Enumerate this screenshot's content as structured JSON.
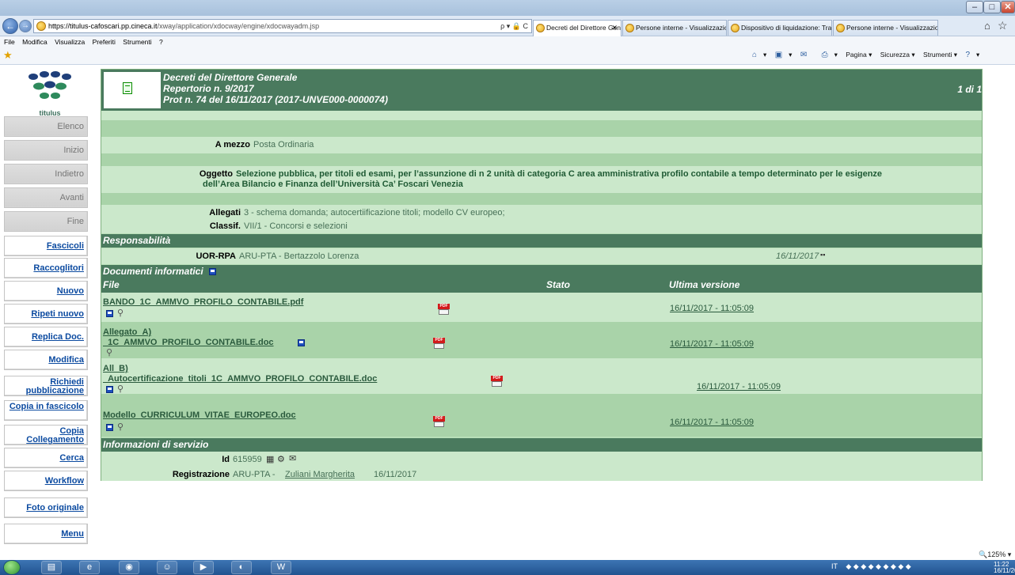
{
  "browser": {
    "address": {
      "host": "https://titulus-cafoscari.pp.cineca.it",
      "path": "/xway/application/xdocway/engine/xdocwayadm.jsp",
      "tools": "ρ ▾ 🔒 C"
    },
    "tabs": [
      {
        "label": "Decreti del Direttore Genera...",
        "active": true
      },
      {
        "label": "Persone interne - Visualizzazio..."
      },
      {
        "label": "Dispositivo di liquidazione: Tra..."
      },
      {
        "label": "Persone interne - Visualizzazio..."
      }
    ],
    "menu": [
      "File",
      "Modifica",
      "Visualizza",
      "Preferiti",
      "Strumenti",
      "?"
    ],
    "command_bar": [
      "Pagina ▾",
      "Sicurezza ▾",
      "Strumenti ▾"
    ],
    "zoom": "125%"
  },
  "logo": {
    "text": "titulus"
  },
  "sidebar": [
    {
      "label": "Elenco",
      "state": "disabled"
    },
    {
      "label": "Inizio",
      "state": "disabled"
    },
    {
      "label": "Indietro",
      "state": "disabled"
    },
    {
      "label": "Avanti",
      "state": "disabled"
    },
    {
      "label": "Fine",
      "state": "disabled"
    },
    {
      "label": "Fascicoli",
      "state": "active"
    },
    {
      "label": "Raccoglitori",
      "state": "active"
    },
    {
      "label": "Nuovo",
      "state": "active"
    },
    {
      "label": "Ripeti nuovo",
      "state": "active"
    },
    {
      "label": "Replica Doc.",
      "state": "active"
    },
    {
      "label": "Modifica",
      "state": "active"
    },
    {
      "label": "Richiedi pubblicazione",
      "state": "active"
    },
    {
      "label": "Copia in fascicolo",
      "state": "active"
    },
    {
      "label": "Copia Collegamento",
      "state": "active"
    },
    {
      "label": "Cerca",
      "state": "active"
    },
    {
      "label": "Workflow",
      "state": "active"
    },
    {
      "label": "Foto originale",
      "state": "active"
    },
    {
      "label": "Menu",
      "state": "active"
    }
  ],
  "doc": {
    "title": "Decreti del Direttore Generale",
    "repertorio": "Repertorio n. 9/2017",
    "protocollo": "Prot n. 74 del 16/11/2017  (2017-UNVE000-0000074)",
    "page": "1 di 1",
    "a_mezzo": {
      "label": "A mezzo",
      "value": "Posta Ordinaria"
    },
    "oggetto": {
      "label": "Oggetto",
      "line1": "Selezione pubblica, per titoli ed esami, per l’assunzione di n 2 unità di categoria C area amministrativa profilo contabile a tempo determinato per le esigenze",
      "line2": "dell’Area Bilancio e Finanza dell’Università Ca’ Foscari Venezia"
    },
    "allegati": {
      "label": "Allegati",
      "value": "3 -  schema domanda; autocertiificazione titoli; modello CV europeo;"
    },
    "classif": {
      "label": "Classif.",
      "value": "VII/1 - Concorsi e selezioni"
    }
  },
  "responsabilita": {
    "heading": "Responsabilità",
    "label": "UOR-RPA",
    "value": "ARU-PTA - Bertazzolo Lorenza",
    "date": "16/11/2017"
  },
  "documenti": {
    "heading": "Documenti informatici",
    "columns": {
      "file": "File",
      "stato": "Stato",
      "ultima": "Ultima versione"
    },
    "pdf_badge": "PDF",
    "files": [
      {
        "line1": "BANDO_1C_AMMVO_PROFILO_CONTABILE.pdf",
        "line2": "",
        "date": "16/11/2017 - 11:05:09"
      },
      {
        "line1": "Allegato_A)",
        "line2": "_1C_AMMVO_PROFILO_CONTABILE.doc",
        "date": "16/11/2017 - 11:05:09"
      },
      {
        "line1": "All_B)",
        "line2": "_Autocertificazione_titoli_1C_AMMVO_PROFILO_CONTABILE.doc",
        "date": "16/11/2017 - 11:05:09"
      },
      {
        "line1": "Modello_CURRICULUM_VITAE_EUROPEO.doc",
        "line2": "",
        "date": "16/11/2017 - 11:05:09"
      }
    ]
  },
  "servizio": {
    "heading": "Informazioni di servizio",
    "id_label": "Id",
    "id_value": "615959",
    "reg_label": "Registrazione",
    "reg_office": "ARU-PTA -",
    "reg_person": "Zuliani Margherita",
    "reg_date": "16/11/2017"
  },
  "taskbar": {
    "lang": "IT",
    "time": "11:22",
    "date": "16/11/2017"
  }
}
